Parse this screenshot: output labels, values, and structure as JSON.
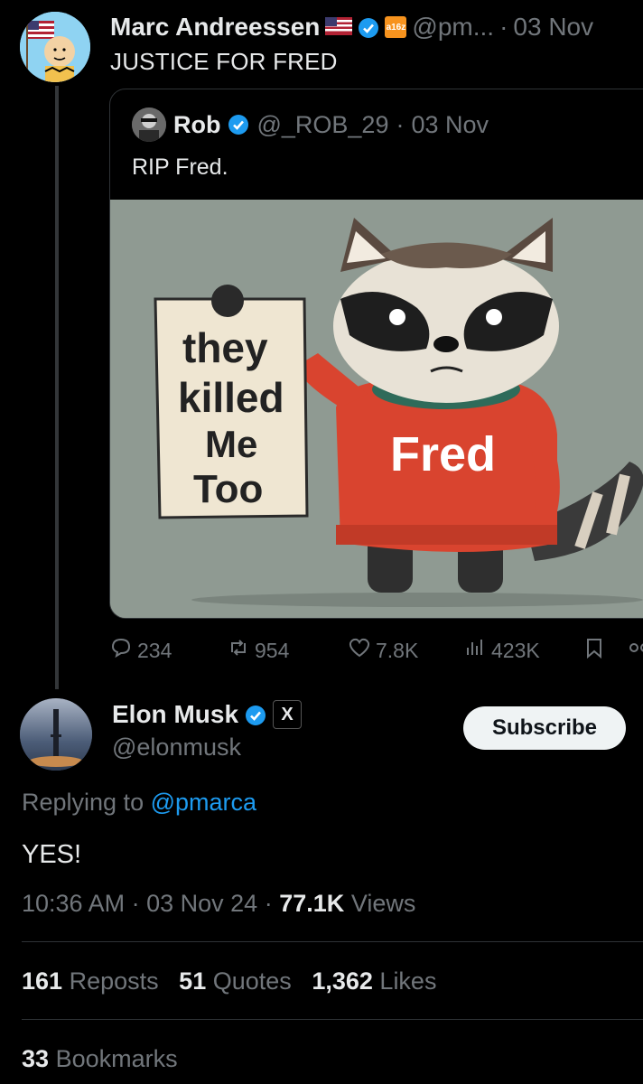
{
  "parent_tweet": {
    "author_name": "Marc Andreessen",
    "flag_icon": "us-flag-icon",
    "badge_label": "a16z",
    "handle": "@pm...",
    "separator": "·",
    "date": "03 Nov",
    "text": "JUSTICE FOR FRED"
  },
  "quote_tweet": {
    "author_name": "Rob",
    "handle": "@_ROB_29",
    "separator": "·",
    "date": "03 Nov",
    "text": "RIP Fred.",
    "image": {
      "sign_lines": [
        "they",
        "killed",
        "Me",
        "Too"
      ],
      "sweater_text": "Fred"
    }
  },
  "actions": {
    "replies": "234",
    "reposts": "954",
    "likes": "7.8K",
    "views": "423K"
  },
  "main_tweet": {
    "author_name": "Elon Musk",
    "x_badge": "X",
    "handle": "@elonmusk",
    "subscribe_label": "Subscribe",
    "replying_prefix": "Replying to",
    "replying_to": "@pmarca",
    "text": "YES!",
    "time": "10:36 AM",
    "date": "03 Nov 24",
    "views_count": "77.1K",
    "views_label": "Views",
    "separator": "·"
  },
  "stats": {
    "reposts_count": "161",
    "reposts_label": "Reposts",
    "quotes_count": "51",
    "quotes_label": "Quotes",
    "likes_count": "1,362",
    "likes_label": "Likes",
    "bookmarks_count": "33",
    "bookmarks_label": "Bookmarks"
  },
  "colors": {
    "background": "#000000",
    "text": "#e7e9ea",
    "muted": "#71767b",
    "link": "#1d9bf0",
    "verified": "#1d9bf0"
  }
}
